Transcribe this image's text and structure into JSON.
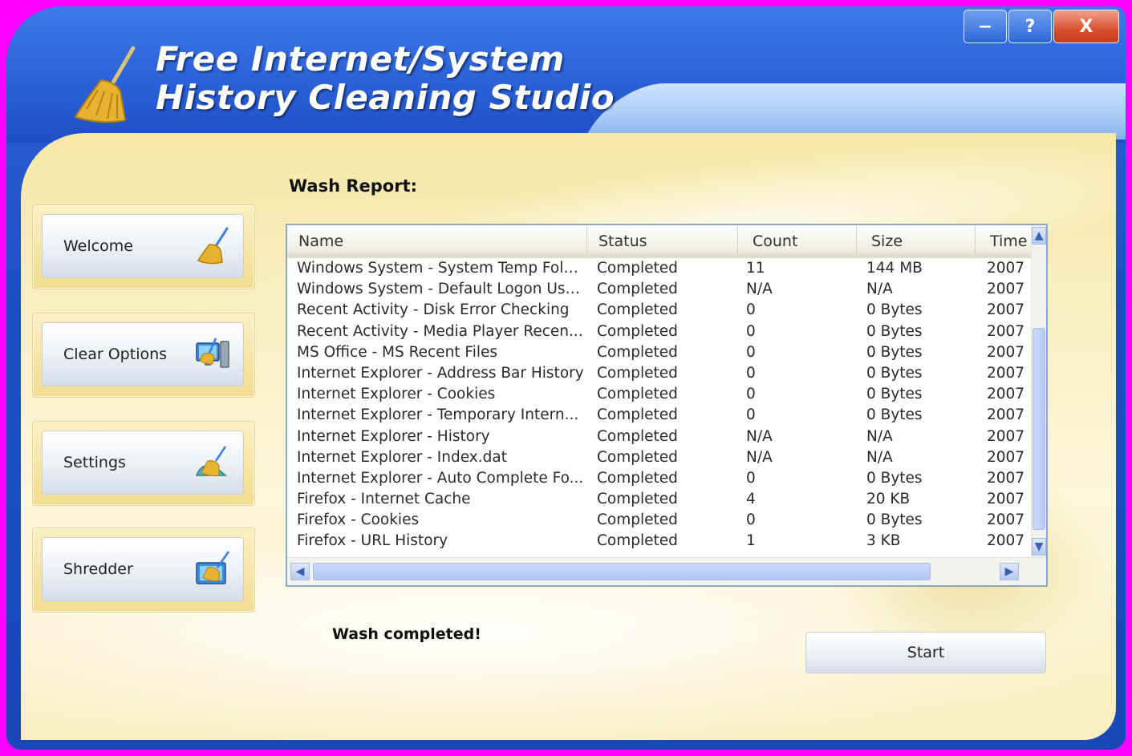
{
  "window": {
    "title_line1": "Free Internet/System",
    "title_line2": "History Cleaning Studio",
    "controls": {
      "minimize": "−",
      "help": "?",
      "close": "X"
    }
  },
  "sidebar": {
    "items": [
      {
        "label": "Welcome",
        "icon": "broom-icon"
      },
      {
        "label": "Clear Options",
        "icon": "computer-broom-icon"
      },
      {
        "label": "Settings",
        "icon": "settings-broom-icon"
      },
      {
        "label": "Shredder",
        "icon": "shredder-broom-icon"
      }
    ]
  },
  "report": {
    "label": "Wash Report:",
    "columns": [
      "Name",
      "Status",
      "Count",
      "Size",
      "Time"
    ],
    "rows": [
      {
        "name": "Windows System - System Temp Folder",
        "status": "Completed",
        "count": "11",
        "size": "144 MB",
        "time": "2007"
      },
      {
        "name": "Windows System - Default Logon Use...",
        "status": "Completed",
        "count": "N/A",
        "size": "N/A",
        "time": "2007"
      },
      {
        "name": "Recent Activity - Disk Error Checking",
        "status": "Completed",
        "count": "0",
        "size": "0 Bytes",
        "time": "2007"
      },
      {
        "name": "Recent Activity - Media Player Recen...",
        "status": "Completed",
        "count": "0",
        "size": "0 Bytes",
        "time": "2007"
      },
      {
        "name": "MS Office - MS Recent Files",
        "status": "Completed",
        "count": "0",
        "size": "0 Bytes",
        "time": "2007"
      },
      {
        "name": "Internet Explorer - Address Bar History",
        "status": "Completed",
        "count": "0",
        "size": "0 Bytes",
        "time": "2007"
      },
      {
        "name": "Internet Explorer - Cookies",
        "status": "Completed",
        "count": "0",
        "size": "0 Bytes",
        "time": "2007"
      },
      {
        "name": "Internet Explorer - Temporary Intern...",
        "status": "Completed",
        "count": "0",
        "size": "0 Bytes",
        "time": "2007"
      },
      {
        "name": "Internet Explorer - History",
        "status": "Completed",
        "count": "N/A",
        "size": "N/A",
        "time": "2007"
      },
      {
        "name": "Internet Explorer - Index.dat",
        "status": "Completed",
        "count": "N/A",
        "size": "N/A",
        "time": "2007"
      },
      {
        "name": "Internet Explorer - Auto Complete Fo...",
        "status": "Completed",
        "count": "0",
        "size": "0 Bytes",
        "time": "2007"
      },
      {
        "name": "Firefox - Internet Cache",
        "status": "Completed",
        "count": "4",
        "size": "20 KB",
        "time": "2007"
      },
      {
        "name": "Firefox - Cookies",
        "status": "Completed",
        "count": "0",
        "size": "0 Bytes",
        "time": "2007"
      },
      {
        "name": "Firefox - URL History",
        "status": "Completed",
        "count": "1",
        "size": "3 KB",
        "time": "2007"
      }
    ]
  },
  "status": {
    "text": "Wash completed!"
  },
  "actions": {
    "start_label": "Start"
  },
  "colors": {
    "frame_blue": "#2a5fd6",
    "client_yellow": "#f6e8a8",
    "close_red": "#d8502c"
  }
}
